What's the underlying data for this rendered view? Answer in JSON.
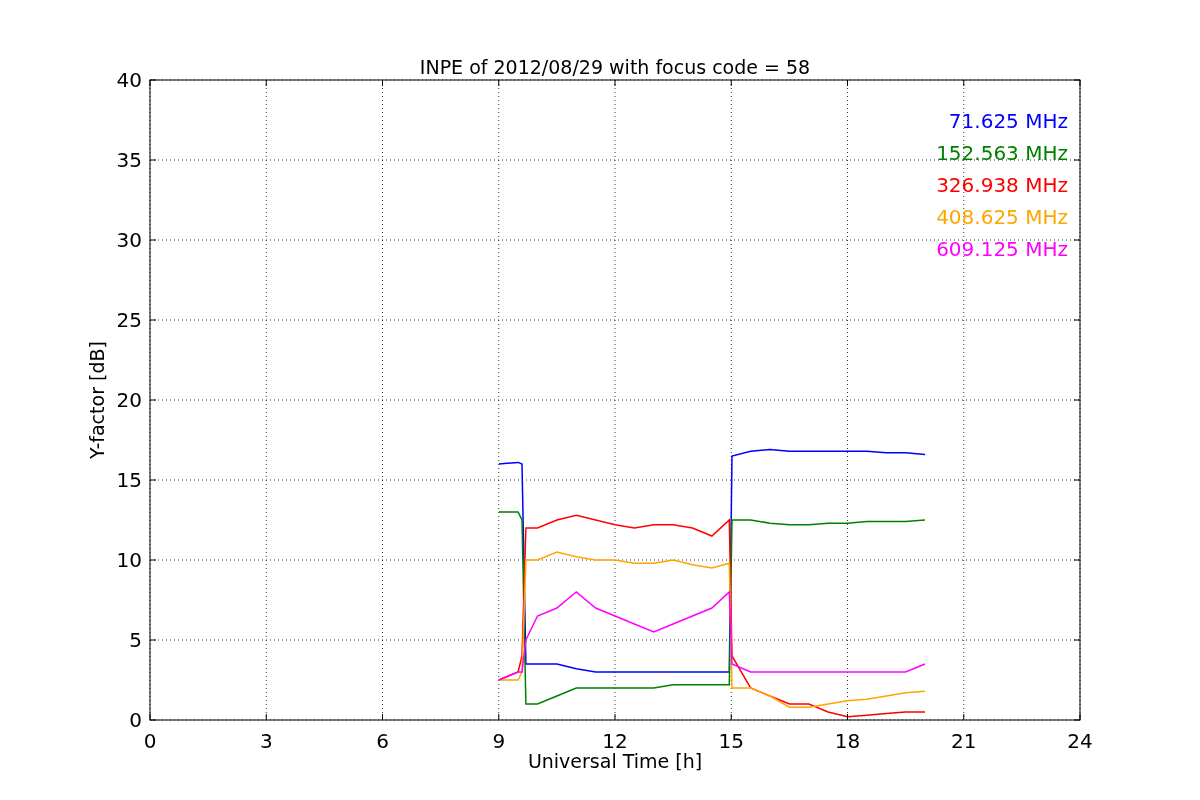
{
  "figure": {
    "chart_data": {
      "type": "line",
      "title": "INPE of 2012/08/29 with focus code = 58",
      "xlabel": "Universal Time [h]",
      "ylabel": "Y-factor [dB]",
      "x": [
        9,
        9.5,
        9.6,
        9.7,
        10,
        10.5,
        11,
        11.5,
        12,
        12.5,
        13,
        13.5,
        14,
        14.5,
        14.95,
        15.02,
        15.5,
        16,
        16.5,
        17,
        17.5,
        18,
        18.5,
        19,
        19.5,
        20
      ],
      "series": [
        {
          "name": "71.625 MHz",
          "color": "#0000ff",
          "values": [
            16,
            16.1,
            16,
            3.5,
            3.5,
            3.5,
            3.2,
            3,
            3,
            3,
            3,
            3,
            3,
            3,
            3,
            16.5,
            16.8,
            16.9,
            16.8,
            16.8,
            16.8,
            16.8,
            16.8,
            16.7,
            16.7,
            16.6
          ]
        },
        {
          "name": "152.563 MHz",
          "color": "#008000",
          "values": [
            13,
            13,
            12.5,
            1,
            1,
            1.5,
            2,
            2,
            2,
            2,
            2,
            2.2,
            2.2,
            2.2,
            2.2,
            12.5,
            12.5,
            12.3,
            12.2,
            12.2,
            12.3,
            12.3,
            12.4,
            12.4,
            12.4,
            12.5
          ]
        },
        {
          "name": "326.938 MHz",
          "color": "#ff0000",
          "values": [
            2.5,
            3,
            4,
            12,
            12,
            12.5,
            12.8,
            12.5,
            12.2,
            12,
            12.2,
            12.2,
            12,
            11.5,
            12.5,
            4,
            2,
            1.5,
            1,
            1,
            0.5,
            0.2,
            0.3,
            0.4,
            0.5,
            0.5
          ]
        },
        {
          "name": "408.625 MHz",
          "color": "#ffa500",
          "values": [
            2.5,
            2.5,
            3,
            10,
            10,
            10.5,
            10.2,
            10,
            10,
            9.8,
            9.8,
            10,
            9.7,
            9.5,
            9.8,
            2,
            2,
            1.5,
            0.8,
            0.8,
            1,
            1.2,
            1.3,
            1.5,
            1.7,
            1.8
          ]
        },
        {
          "name": "609.125 MHz",
          "color": "#ff00ff",
          "values": [
            2.5,
            3,
            3,
            5,
            6.5,
            7,
            8,
            7,
            6.5,
            6,
            5.5,
            6,
            6.5,
            7,
            8,
            3.5,
            3,
            3,
            3,
            3,
            3,
            3,
            3,
            3,
            3,
            3.5
          ]
        }
      ],
      "grid": true,
      "xlim": [
        0,
        24
      ],
      "ylim": [
        0,
        40
      ],
      "xticks": [
        0,
        3,
        6,
        9,
        12,
        15,
        18,
        21,
        24
      ],
      "yticks": [
        0,
        5,
        10,
        15,
        20,
        25,
        30,
        35,
        40
      ]
    }
  }
}
